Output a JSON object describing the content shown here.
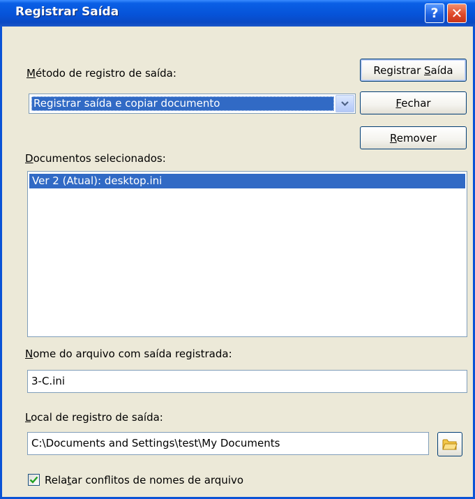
{
  "window": {
    "title": "Registrar Saída",
    "help_label": "?",
    "close_label": "✕"
  },
  "method": {
    "label_first": "M",
    "label_rest": "étodo de registro de saída:",
    "selected": "Registrar saída e copiar documento"
  },
  "buttons": {
    "register_pre": "Registrar ",
    "register_key": "S",
    "register_post": "aída",
    "close_key": "F",
    "close_rest": "echar",
    "remove_key": "R",
    "remove_rest": "emover"
  },
  "documents": {
    "label_first": "D",
    "label_rest": "ocumentos selecionados:",
    "items": [
      "Ver  2 (Atual): desktop.ini"
    ]
  },
  "filename": {
    "label_first": "N",
    "label_rest": "ome do arquivo com saída registrada:",
    "value": "3-C.ini"
  },
  "location": {
    "label_first": "L",
    "label_rest": "ocal de registro de saída:",
    "value": "C:\\Documents and Settings\\test\\My Documents",
    "browse_icon": "folder-icon"
  },
  "report": {
    "checked": true,
    "label_pre": "Rela",
    "label_key": "t",
    "label_post": "ar conflitos de nomes de arquivo"
  }
}
